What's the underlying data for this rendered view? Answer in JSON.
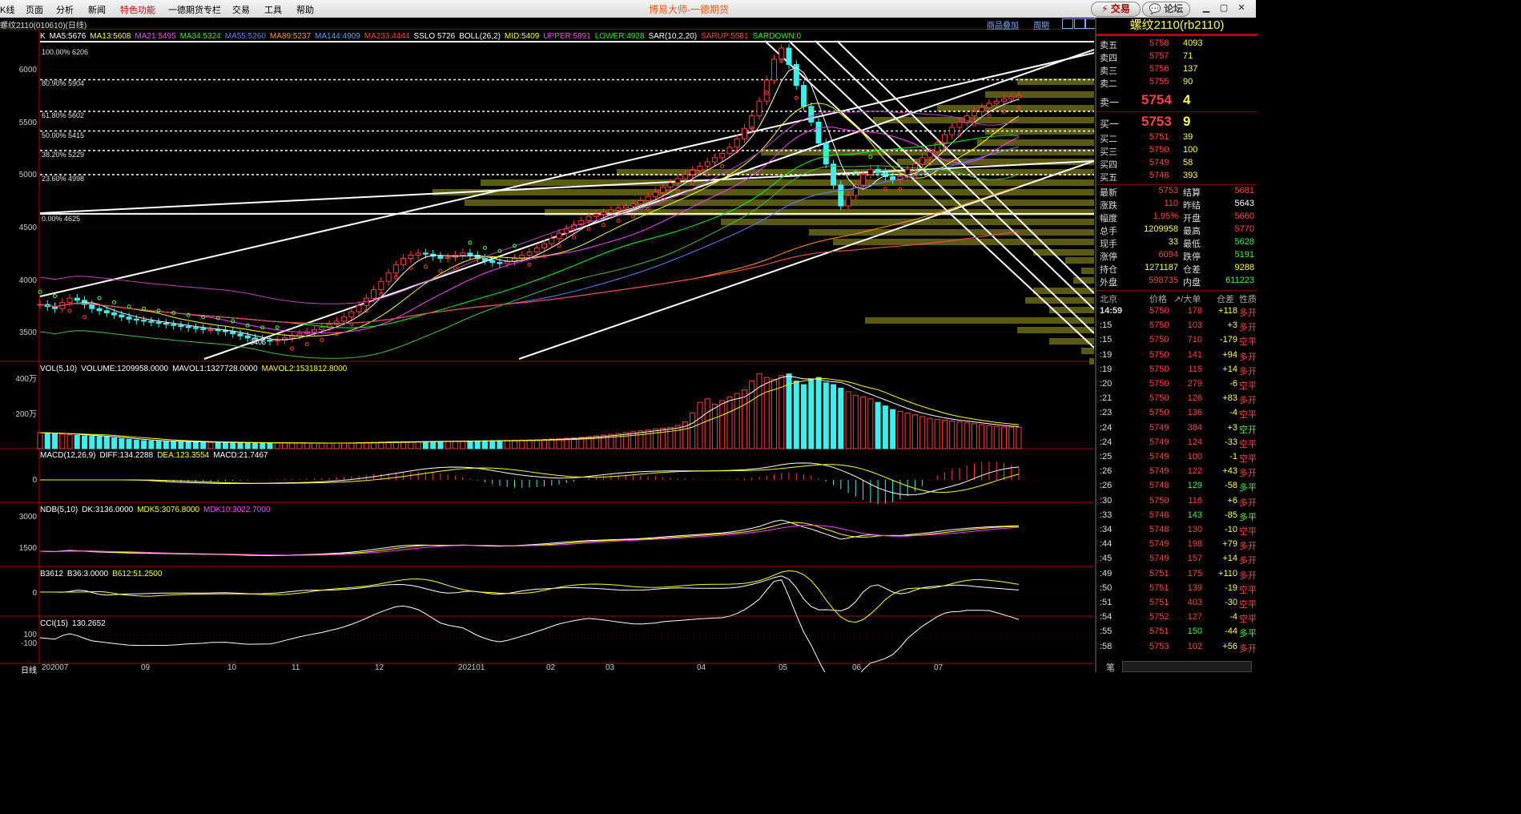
{
  "menu": {
    "items": [
      "K线",
      "页面",
      "分析",
      "新闻",
      "特色功能",
      "一德期货专栏",
      "交易",
      "工具",
      "帮助"
    ],
    "title": "博易大师-一德期货",
    "trade_btn": "交易",
    "forum_btn": "论坛"
  },
  "colors": {
    "up": "#ff3b3b",
    "down": "#3cf0f0",
    "yellow": "#ffff40",
    "white": "#ffffff",
    "green": "#00ff00",
    "grid": "#7a0000"
  },
  "chart_header": {
    "symbol": "螺纹2110(010610)(日线)",
    "overlay_btn": "商品叠加",
    "period_btn": "周期"
  },
  "indicators": {
    "main": [
      {
        "t": "K",
        "c": "#ffffff"
      },
      {
        "t": "MA5:5676",
        "c": "#ffffff"
      },
      {
        "t": "MA13:5608",
        "c": "#ffff00"
      },
      {
        "t": "MA21:5495",
        "c": "#ff40ff"
      },
      {
        "t": "MA34:5324",
        "c": "#00ff00"
      },
      {
        "t": "MA55:5260",
        "c": "#6080ff"
      },
      {
        "t": "MA89:5237",
        "c": "#ff9900"
      },
      {
        "t": "MA144:4909",
        "c": "#4aa3ff"
      },
      {
        "t": "MA233:4444",
        "c": "#ff4040"
      },
      {
        "t": "SSLO 5726",
        "c": "#ffffff"
      },
      {
        "t": "BOLL(26,2)",
        "c": "#ffffff"
      },
      {
        "t": "MID:5409",
        "c": "#ffff00"
      },
      {
        "t": "UPPER:5891",
        "c": "#ff40ff"
      },
      {
        "t": "LOWER:4928",
        "c": "#00ff00"
      },
      {
        "t": "SAR(10,2,20)",
        "c": "#ffffff"
      },
      {
        "t": "SARUP:5581",
        "c": "#ff4040"
      },
      {
        "t": "SARDOWN:0",
        "c": "#00ff00"
      }
    ],
    "vol": [
      {
        "t": "VOL(5,10)",
        "c": "#ffffff"
      },
      {
        "t": "VOLUME:1209958.0000",
        "c": "#ffffff"
      },
      {
        "t": "MAVOL1:1327728.0000",
        "c": "#ffffff"
      },
      {
        "t": "MAVOL2:1531812.8000",
        "c": "#ffff00"
      }
    ],
    "macd": [
      {
        "t": "MACD(12,26,9)",
        "c": "#ffffff"
      },
      {
        "t": "DIFF:134.2288",
        "c": "#ffffff"
      },
      {
        "t": "DEA:123.3554",
        "c": "#ffff00"
      },
      {
        "t": "MACD:21.7467",
        "c": "#ffffff"
      }
    ],
    "ndb": [
      {
        "t": "NDB(5,10)",
        "c": "#ffffff"
      },
      {
        "t": "DK:3136.0000",
        "c": "#ffffff"
      },
      {
        "t": "MDK5:3076.8000",
        "c": "#ffff00"
      },
      {
        "t": "MDK10:3022.7000",
        "c": "#ff40ff"
      }
    ],
    "b3612": [
      {
        "t": "B3612",
        "c": "#ffffff"
      },
      {
        "t": "B36:3.0000",
        "c": "#ffffff"
      },
      {
        "t": "B612:51.2500",
        "c": "#ffff00"
      }
    ],
    "cci": [
      {
        "t": "CCI(15)",
        "c": "#ffffff"
      },
      {
        "t": "130.2652",
        "c": "#ffffff"
      }
    ]
  },
  "fib": [
    {
      "label": "100.00% 6206",
      "price": 6206,
      "solid": true
    },
    {
      "label": "80.90% 5904",
      "price": 5904,
      "solid": false
    },
    {
      "label": "61.80% 5602",
      "price": 5602,
      "solid": false
    },
    {
      "label": "50.00% 5415",
      "price": 5415,
      "solid": false
    },
    {
      "label": "38.20% 5229",
      "price": 5229,
      "solid": false
    },
    {
      "label": "23.60% 4998",
      "price": 4998,
      "solid": false
    },
    {
      "label": "0.00% 4625",
      "price": 4625,
      "solid": true
    }
  ],
  "yaxis": {
    "main": [
      "6000",
      "5500",
      "5000",
      "4500",
      "4000",
      "3500"
    ],
    "vol": [
      "400万",
      "200万"
    ],
    "macd": [
      "0"
    ],
    "ndb": [
      "3000",
      "1500"
    ],
    "b3612": [
      "0"
    ],
    "cci": [
      "100",
      "-100"
    ]
  },
  "low_marker": "3405",
  "xaxis": {
    "period_label": "日线",
    "labels": [
      "202007",
      "09",
      "10",
      "11",
      "12",
      "202101",
      "02",
      "03",
      "04",
      "05",
      "06",
      "07"
    ]
  },
  "chart_data": {
    "type": "candlestick",
    "symbol": "rb2110",
    "period": "daily",
    "ylim": [
      3350,
      6350
    ],
    "indicators_last": {
      "MA5": 5676,
      "MA13": 5608,
      "MA21": 5495,
      "MA34": 5324,
      "MA55": 5260,
      "MA89": 5237,
      "MA144": 4909,
      "MA233": 4444,
      "UPPER": 5891,
      "MID": 5409,
      "LOWER": 4928,
      "VOLUME": 1209958,
      "MAVOL1": 1327728,
      "MAVOL2": 1531812.8,
      "DIFF": 134.2288,
      "DEA": 123.3554,
      "MACD": 21.7467,
      "DK": 3136,
      "MDK5": 3076.8,
      "MDK10": 3022.7,
      "B36": 3.0,
      "B612": 51.25,
      "CCI": 130.2652
    },
    "closes": [
      3760,
      3740,
      3720,
      3780,
      3820,
      3800,
      3760,
      3720,
      3700,
      3680,
      3660,
      3640,
      3620,
      3610,
      3600,
      3590,
      3580,
      3570,
      3560,
      3550,
      3540,
      3530,
      3520,
      3520,
      3510,
      3500,
      3480,
      3460,
      3440,
      3430,
      3420,
      3410,
      3420,
      3440,
      3460,
      3480,
      3500,
      3520,
      3540,
      3570,
      3600,
      3640,
      3690,
      3750,
      3820,
      3900,
      3980,
      4060,
      4140,
      4200,
      4230,
      4250,
      4240,
      4220,
      4200,
      4210,
      4230,
      4250,
      4230,
      4200,
      4180,
      4160,
      4150,
      4170,
      4200,
      4230,
      4260,
      4300,
      4340,
      4390,
      4440,
      4480,
      4520,
      4560,
      4600,
      4620,
      4640,
      4660,
      4680,
      4700,
      4720,
      4750,
      4790,
      4830,
      4880,
      4920,
      4960,
      5000,
      5040,
      5080,
      5120,
      5160,
      5200,
      5260,
      5340,
      5440,
      5560,
      5700,
      5900,
      6100,
      6206,
      6050,
      5850,
      5650,
      5500,
      5300,
      5100,
      4900,
      4700,
      4800,
      4900,
      5000,
      5050,
      5020,
      4980,
      4950,
      4980,
      5050,
      5100,
      5160,
      5220,
      5300,
      5380,
      5450,
      5500,
      5560,
      5600,
      5640,
      5680,
      5700,
      5720,
      5740,
      5753
    ],
    "volumes": [
      900000,
      880000,
      850000,
      820000,
      780000,
      750000,
      720000,
      700000,
      680000,
      650000,
      600000,
      560000,
      520000,
      480000,
      450000,
      430000,
      420000,
      410000,
      400000,
      390000,
      380000,
      370000,
      360000,
      355000,
      350000,
      345000,
      340000,
      335000,
      330000,
      328000,
      326000,
      324000,
      322000,
      320000,
      318000,
      316000,
      314000,
      312000,
      310000,
      312000,
      316000,
      320000,
      330000,
      340000,
      350000,
      360000,
      370000,
      380000,
      385000,
      390000,
      395000,
      400000,
      405000,
      410000,
      415000,
      420000,
      425000,
      430000,
      435000,
      440000,
      445000,
      450000,
      455000,
      460000,
      470000,
      480000,
      490000,
      500000,
      520000,
      540000,
      560000,
      580000,
      600000,
      640000,
      680000,
      720000,
      760000,
      800000,
      850000,
      900000,
      950000,
      1000000,
      1050000,
      1100000,
      1150000,
      1200000,
      1300000,
      1500000,
      2000000,
      2600000,
      2800000,
      2500000,
      2700000,
      2900000,
      3100000,
      3300000,
      3800000,
      4200000,
      4000000,
      3900000,
      4100000,
      4200000,
      3800000,
      3600000,
      3900000,
      4000000,
      3700000,
      3600000,
      3400000,
      3200000,
      3000000,
      2900000,
      2800000,
      2600000,
      2400000,
      2200000,
      2100000,
      2000000,
      1900000,
      1800000,
      1700000,
      1650000,
      1600000,
      1550000,
      1500000,
      1450000,
      1400000,
      1350000,
      1300000,
      1250000,
      1220000,
      1210000,
      1209958
    ]
  },
  "quote_panel": {
    "title": "螺纹2110(rb2110)",
    "asks": [
      {
        "label": "卖五",
        "price": "5758",
        "vol": "4093"
      },
      {
        "label": "卖四",
        "price": "5757",
        "vol": "71"
      },
      {
        "label": "卖三",
        "price": "5756",
        "vol": "137"
      },
      {
        "label": "卖二",
        "price": "5755",
        "vol": "90"
      }
    ],
    "ask1": {
      "label": "卖一",
      "price": "5754",
      "vol": "4"
    },
    "bid1": {
      "label": "买一",
      "price": "5753",
      "vol": "9"
    },
    "bids": [
      {
        "label": "买二",
        "price": "5751",
        "vol": "39"
      },
      {
        "label": "买三",
        "price": "5750",
        "vol": "100"
      },
      {
        "label": "买四",
        "price": "5749",
        "vol": "58"
      },
      {
        "label": "买五",
        "price": "5748",
        "vol": "393"
      }
    ],
    "stats": [
      {
        "l1": "最新",
        "v1": "5753",
        "l2": "结算",
        "v2": "5681"
      },
      {
        "l1": "涨跌",
        "v1": "110",
        "l2": "昨结",
        "v2": "5643"
      },
      {
        "l1": "幅度",
        "v1": "1.95%",
        "l2": "开盘",
        "v2": "5660"
      },
      {
        "l1": "总手",
        "v1": "1209958",
        "l2": "最高",
        "v2": "5770"
      },
      {
        "l1": "现手",
        "v1": "33",
        "l2": "最低",
        "v2": "5628"
      },
      {
        "l1": "涨停",
        "v1": "6094",
        "l2": "跌停",
        "v2": "5191"
      },
      {
        "l1": "持仓",
        "v1": "1271187",
        "l2": "仓差",
        "v2": "9288"
      },
      {
        "l1": "外盘",
        "v1": "598735",
        "l2": "内盘",
        "v2": "611223"
      }
    ],
    "tick_header": {
      "city": "北京",
      "price": "价格",
      "big": "↗/大单",
      "oi": "仓差",
      "nature": "性质"
    },
    "ticks": [
      {
        "time": "14:59",
        "price": "5750",
        "vol": "178",
        "oi": "+118",
        "nature": "多开"
      },
      {
        "time": ":15",
        "price": "5750",
        "vol": "103",
        "oi": "+3",
        "nature": "多开"
      },
      {
        "time": ":15",
        "price": "5750",
        "vol": "710",
        "oi": "-179",
        "nature": "空平"
      },
      {
        "time": ":19",
        "price": "5750",
        "vol": "141",
        "oi": "+94",
        "nature": "多开"
      },
      {
        "time": ":19",
        "price": "5750",
        "vol": "115",
        "oi": "+14",
        "nature": "多开"
      },
      {
        "time": ":20",
        "price": "5750",
        "vol": "279",
        "oi": "-6",
        "nature": "空平"
      },
      {
        "time": ":21",
        "price": "5750",
        "vol": "126",
        "oi": "+83",
        "nature": "多开"
      },
      {
        "time": ":23",
        "price": "5750",
        "vol": "136",
        "oi": "-4",
        "nature": "空平"
      },
      {
        "time": ":24",
        "price": "5749",
        "vol": "384",
        "oi": "+3",
        "nature": "空开"
      },
      {
        "time": ":24",
        "price": "5749",
        "vol": "124",
        "oi": "-33",
        "nature": "空平"
      },
      {
        "time": ":25",
        "price": "5749",
        "vol": "100",
        "oi": "-1",
        "nature": "空平"
      },
      {
        "time": ":26",
        "price": "5749",
        "vol": "122",
        "oi": "+43",
        "nature": "多开"
      },
      {
        "time": ":26",
        "price": "5748",
        "vol": "129",
        "oi": "-58",
        "nature": "多平"
      },
      {
        "time": ":30",
        "price": "5750",
        "vol": "116",
        "oi": "+6",
        "nature": "多开"
      },
      {
        "time": ":33",
        "price": "5748",
        "vol": "143",
        "oi": "-85",
        "nature": "多平"
      },
      {
        "time": ":34",
        "price": "5748",
        "vol": "130",
        "oi": "-10",
        "nature": "空平"
      },
      {
        "time": ":44",
        "price": "5749",
        "vol": "198",
        "oi": "+79",
        "nature": "多开"
      },
      {
        "time": ":45",
        "price": "5749",
        "vol": "157",
        "oi": "+14",
        "nature": "多开"
      },
      {
        "time": ":49",
        "price": "5751",
        "vol": "175",
        "oi": "+110",
        "nature": "多开"
      },
      {
        "time": ":50",
        "price": "5751",
        "vol": "139",
        "oi": "-19",
        "nature": "空平"
      },
      {
        "time": ":51",
        "price": "5751",
        "vol": "403",
        "oi": "-30",
        "nature": "空平"
      },
      {
        "time": ":54",
        "price": "5752",
        "vol": "127",
        "oi": "-4",
        "nature": "空平"
      },
      {
        "time": ":55",
        "price": "5751",
        "vol": "150",
        "oi": "-44",
        "nature": "多平"
      },
      {
        "time": ":58",
        "price": "5753",
        "vol": "102",
        "oi": "+56",
        "nature": "多开"
      }
    ],
    "footer": "笔"
  }
}
